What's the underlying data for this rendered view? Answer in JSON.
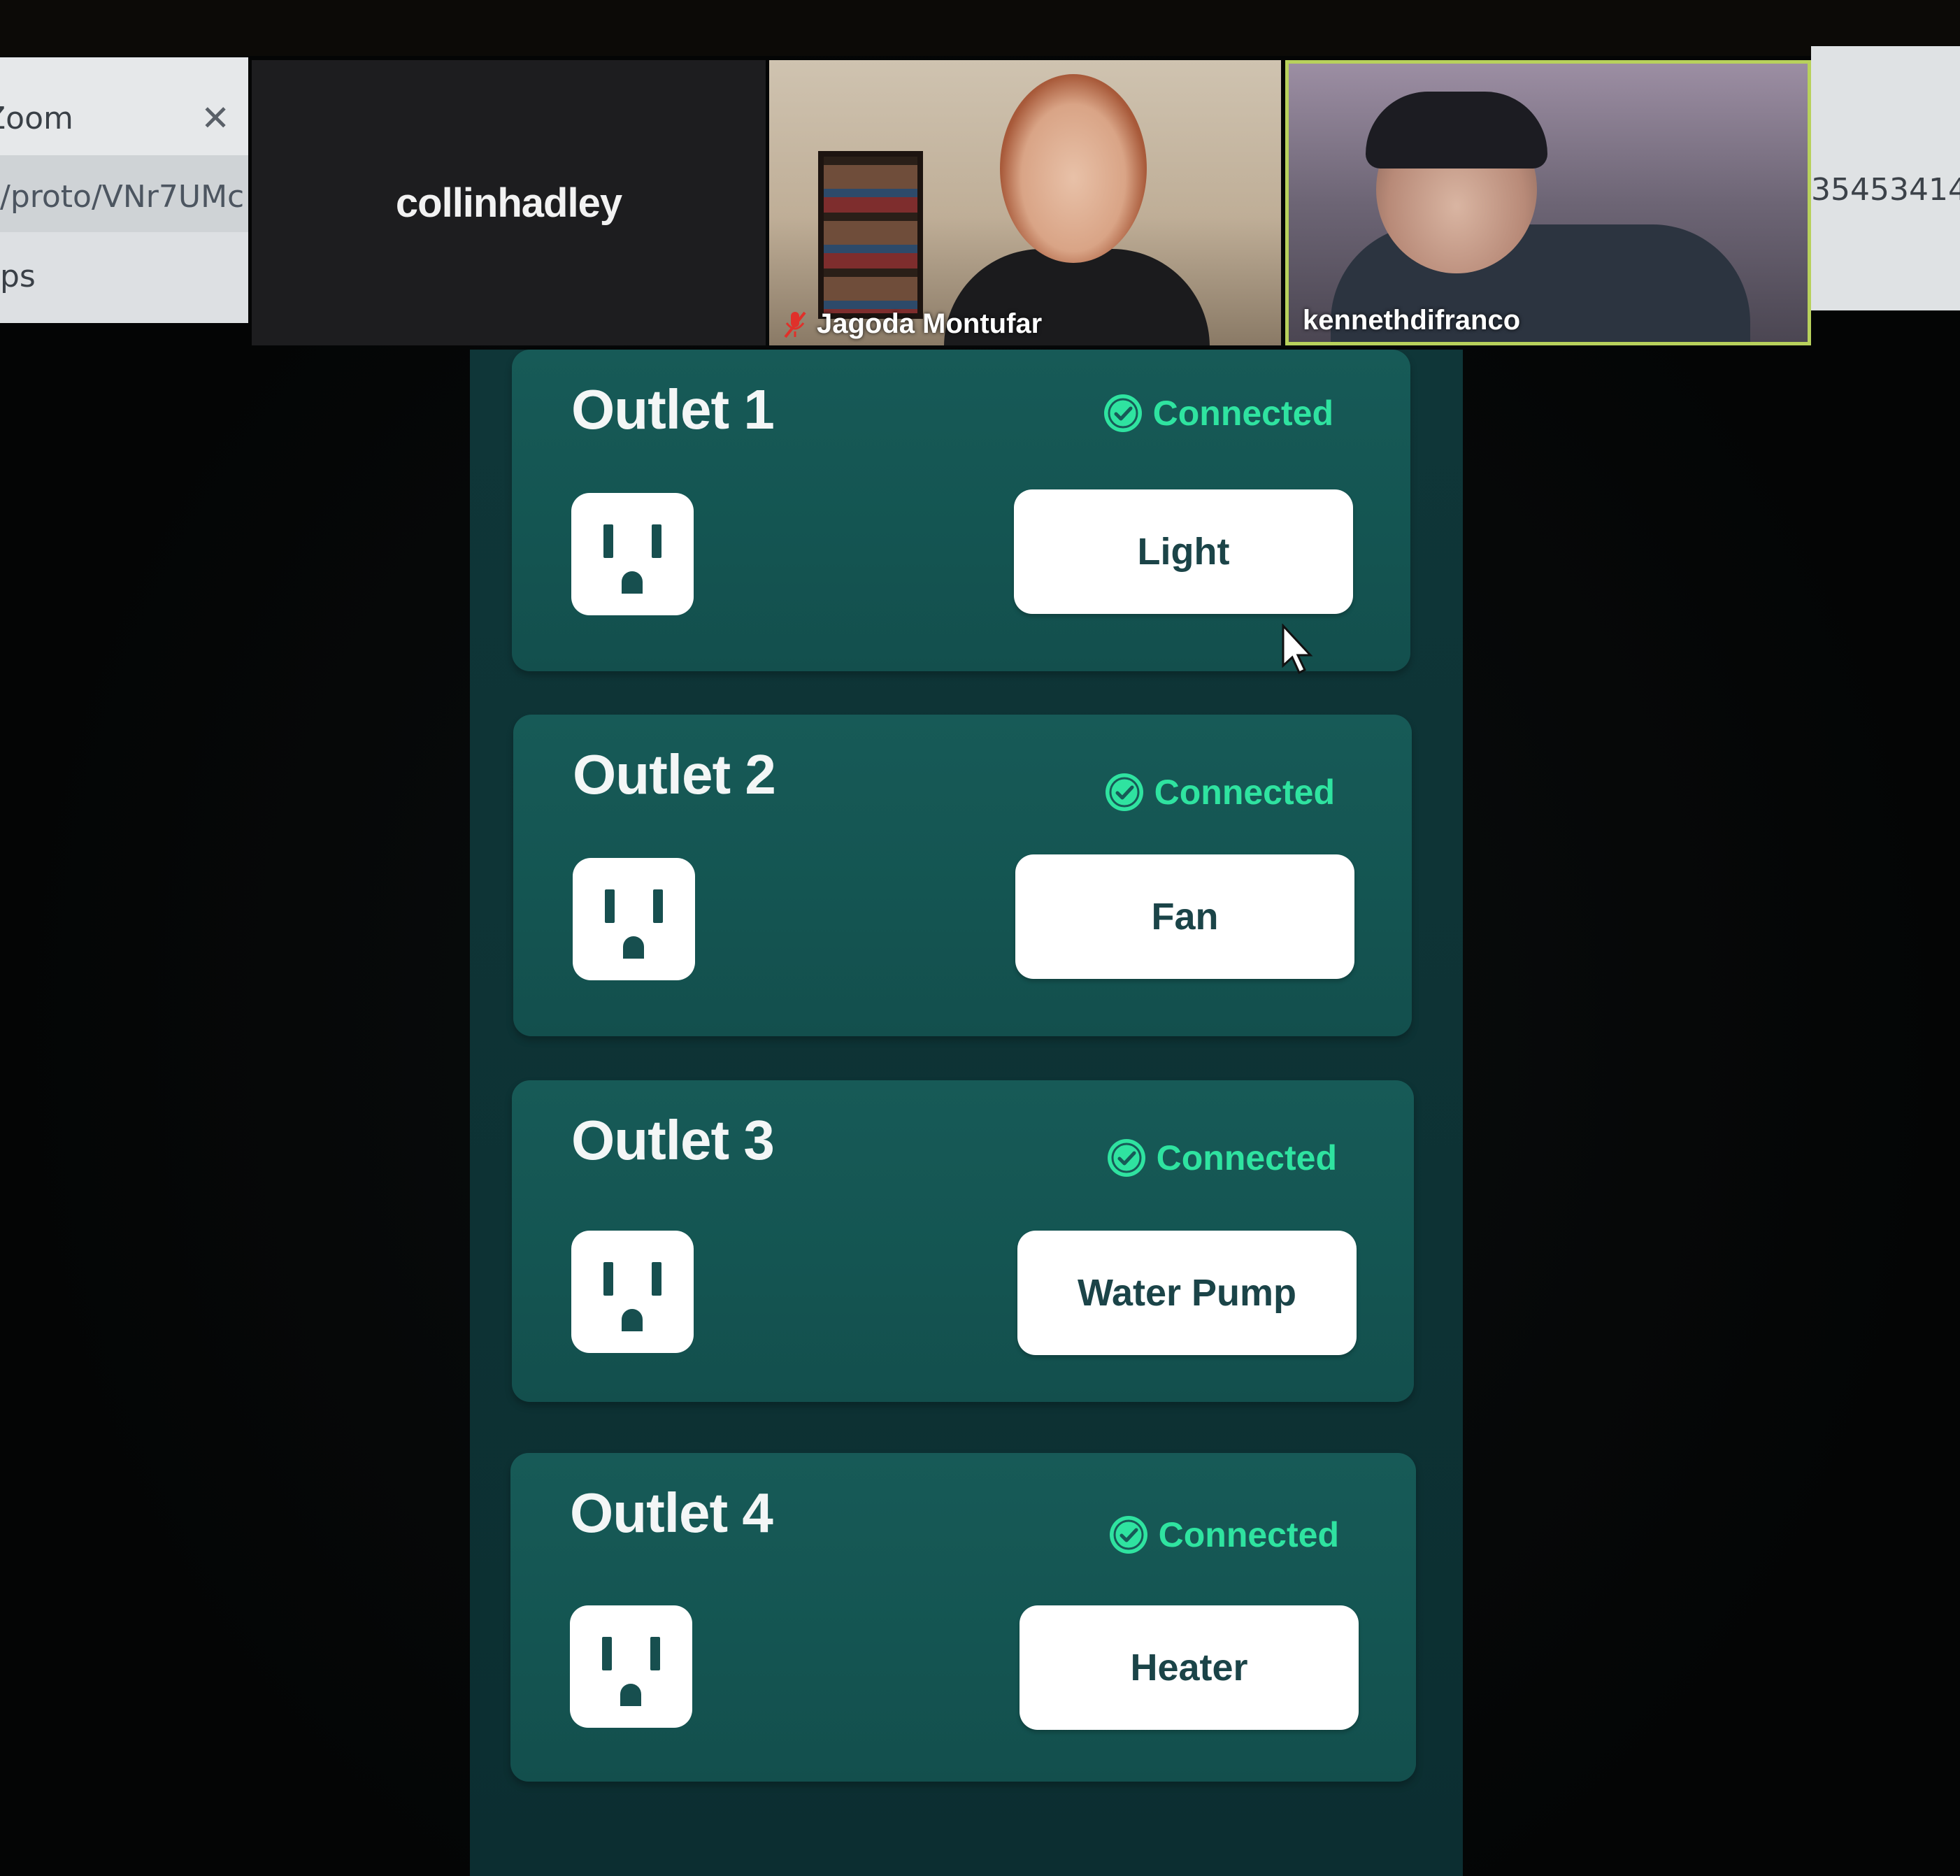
{
  "browser_left": {
    "tab_title": "Zoom",
    "url_fragment": "/proto/VNr7UMc",
    "row_fragment": "ps"
  },
  "browser_right": {
    "number_fragment": "35453414"
  },
  "call": {
    "tiles": [
      {
        "name": "collinhadley",
        "video": false
      },
      {
        "name": "Jagoda Montufar",
        "video": true,
        "muted": true
      },
      {
        "name": "kennethdifranco",
        "video": true,
        "active_speaker": true
      }
    ]
  },
  "outlets": [
    {
      "title": "Outlet 1",
      "status": "Connected",
      "device": "Light"
    },
    {
      "title": "Outlet 2",
      "status": "Connected",
      "device": "Fan"
    },
    {
      "title": "Outlet 3",
      "status": "Connected",
      "device": "Water Pump"
    },
    {
      "title": "Outlet 4",
      "status": "Connected",
      "device": "Heater"
    }
  ],
  "colors": {
    "card_bg": "#155754",
    "status_green": "#2fe3a0",
    "button_text": "#1b4448",
    "speaker_border": "#b8d15c"
  }
}
